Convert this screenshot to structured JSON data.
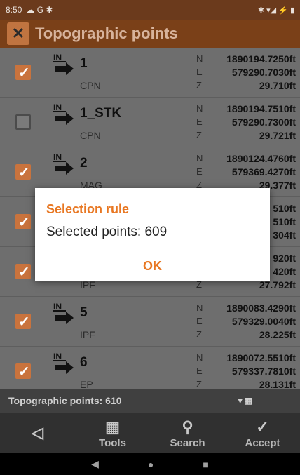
{
  "status_bar": {
    "time": "8:50",
    "left_icons": "☁ G ✱",
    "right_icons": "✱ ▾◢ ⚡ ▮"
  },
  "app": {
    "title": "Topographic points",
    "logo_icon": "app-logo-icon"
  },
  "points": [
    {
      "name": "1",
      "code": "CPN",
      "checked": true,
      "N": "1890194.7250ft",
      "E": "579290.7030ft",
      "Z": "29.710ft"
    },
    {
      "name": "1_STK",
      "code": "CPN",
      "checked": false,
      "N": "1890194.7510ft",
      "E": "579290.7300ft",
      "Z": "29.721ft"
    },
    {
      "name": "2",
      "code": "MAG",
      "checked": true,
      "N": "1890124.4760ft",
      "E": "579369.4270ft",
      "Z": "29.377ft"
    },
    {
      "name": "",
      "code": "",
      "checked": true,
      "N": "510ft",
      "E": "510ft",
      "Z": "304ft"
    },
    {
      "name": "",
      "code": "IPF",
      "checked": true,
      "N": "920ft",
      "E": "420ft",
      "Z": "27.792ft"
    },
    {
      "name": "5",
      "code": "IPF",
      "checked": true,
      "N": "1890083.4290ft",
      "E": "579329.0040ft",
      "Z": "28.225ft"
    },
    {
      "name": "6",
      "code": "EP",
      "checked": true,
      "N": "1890072.5510ft",
      "E": "579337.7810ft",
      "Z": "28.131ft"
    }
  ],
  "labels": {
    "N": "N",
    "E": "E",
    "Z": "Z"
  },
  "footer": {
    "count_text": "Topographic points: 610"
  },
  "toolbar": {
    "back": "",
    "tools": "Tools",
    "search": "Search",
    "accept": "Accept"
  },
  "dialog": {
    "title": "Selection rule",
    "message": "Selected points: 609",
    "ok": "OK"
  },
  "colors": {
    "accent": "#e87722",
    "checkbox": "#c9733d",
    "appbar": "#7a4018"
  }
}
